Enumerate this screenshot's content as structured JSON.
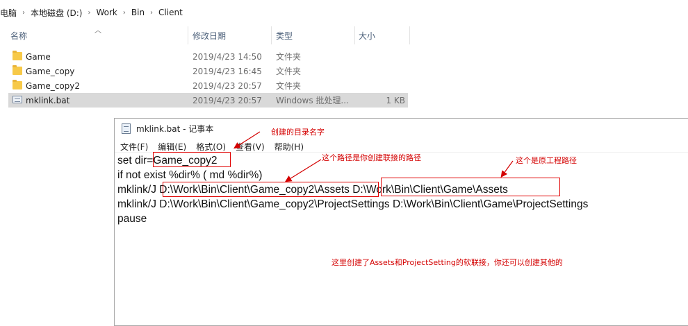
{
  "breadcrumb": {
    "items": [
      "电脑",
      "本地磁盘 (D:)",
      "Work",
      "Bin",
      "Client"
    ],
    "separator": "›"
  },
  "columns": {
    "name": "名称",
    "date": "修改日期",
    "type": "类型",
    "size": "大小"
  },
  "files": [
    {
      "name": "Game",
      "date": "2019/4/23 14:50",
      "type": "文件夹",
      "size": "",
      "icon": "folder-icon"
    },
    {
      "name": "Game_copy",
      "date": "2019/4/23 16:45",
      "type": "文件夹",
      "size": "",
      "icon": "folder-icon"
    },
    {
      "name": "Game_copy2",
      "date": "2019/4/23 20:57",
      "type": "文件夹",
      "size": "",
      "icon": "folder-icon"
    },
    {
      "name": "mklink.bat",
      "date": "2019/4/23 20:57",
      "type": "Windows 批处理...",
      "size": "1 KB",
      "icon": "batch-file-icon",
      "selected": true
    }
  ],
  "notepad": {
    "title": "mklink.bat - 记事本",
    "menu": [
      "文件(F)",
      "编辑(E)",
      "格式(O)",
      "查看(V)",
      "帮助(H)"
    ],
    "lines": [
      "set dir=Game_copy2",
      "if not exist %dir% ( md %dir%)",
      "mklink/J D:\\Work\\Bin\\Client\\Game_copy2\\Assets D:\\Work\\Bin\\Client\\Game\\Assets",
      "mklink/J D:\\Work\\Bin\\Client\\Game_copy2\\ProjectSettings D:\\Work\\Bin\\Client\\Game\\ProjectSettings",
      "pause"
    ]
  },
  "annotations": {
    "dir_name": "创建的目录名字",
    "link_path": "这个路径是你创建联接的路径",
    "source_path": "这个是原工程路径",
    "summary": "这里创建了Assets和ProjectSetting的软联接，你还可以创建其他的"
  },
  "colors": {
    "selection": "#d9d9d9",
    "annotation": "#d40000",
    "folder": "#f7c948",
    "header_text": "#4c607a"
  }
}
